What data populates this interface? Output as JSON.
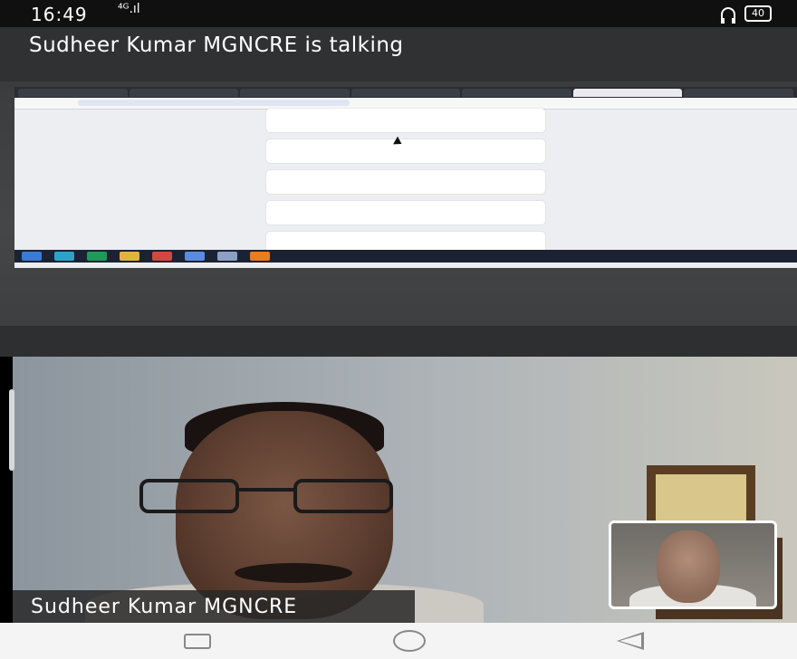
{
  "status_bar": {
    "time": "16:49",
    "signal": "⁴ᴳ.ıl",
    "battery": "40"
  },
  "call": {
    "talking_text": "Sudheer Kumar MGNCRE is talking",
    "speaker_name": "Sudheer Kumar MGNCRE"
  },
  "colors": {
    "top_strip": "#2f3133",
    "nav_bar": "#f4f4f4"
  },
  "icons": [
    "headset-icon",
    "battery-icon",
    "recent-apps-icon",
    "home-icon",
    "back-icon"
  ]
}
